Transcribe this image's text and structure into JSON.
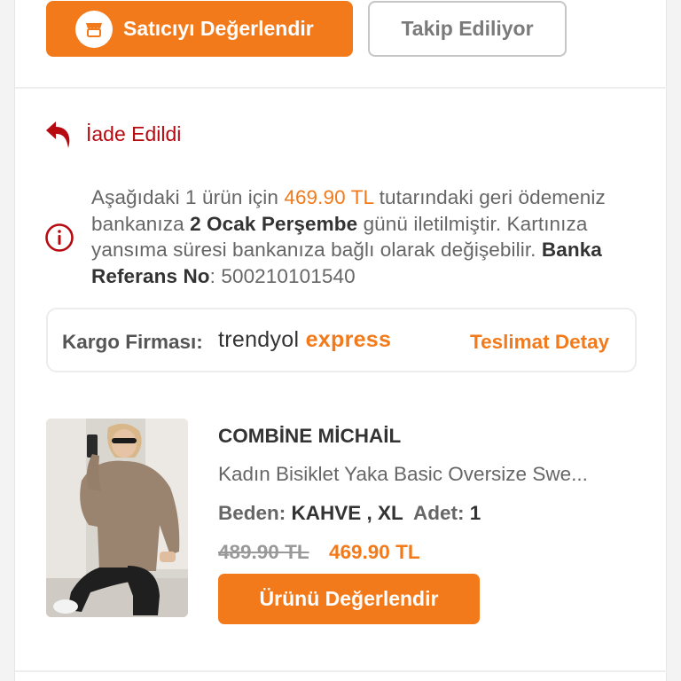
{
  "seller": {
    "rate_label": "Satıcıyı Değerlendir",
    "follow_label": "Takip Ediliyor"
  },
  "return_status": {
    "label": "İade Edildi"
  },
  "refund_info": {
    "part1": "Aşağıdaki 1 ürün için ",
    "amount": "469.90 TL",
    "part2": " tutarındaki geri ödemeniz bankanıza ",
    "date": "2 Ocak Perşembe",
    "part3": " günü iletilmiştir. Kartınıza yansıma süresi bankanıza bağlı olarak değişebilir. ",
    "ref_label": "Banka Referans No",
    "ref_sep": ": ",
    "ref_value": "500210101540"
  },
  "cargo": {
    "label": "Kargo Firması:",
    "logo_part1": "trendyol",
    "logo_part2": " express",
    "detail_link": "Teslimat Detay"
  },
  "product": {
    "brand": "COMBİNE MİCHAİL",
    "name": "Kadın Bisiklet Yaka Basic Oversize Swe...",
    "size_label": "Beden: ",
    "size_value": "KAHVE , XL",
    "qty_label": "  Adet: ",
    "qty_value": "1",
    "old_price": "489.90 TL",
    "new_price": "469.90 TL",
    "review_label": "Ürünü Değerlendir"
  },
  "colors": {
    "accent": "#f27a1a",
    "status_red": "#b70a10"
  },
  "icons": {
    "store": "store-icon",
    "return": "return-arrow-icon",
    "info": "info-circle-icon"
  }
}
